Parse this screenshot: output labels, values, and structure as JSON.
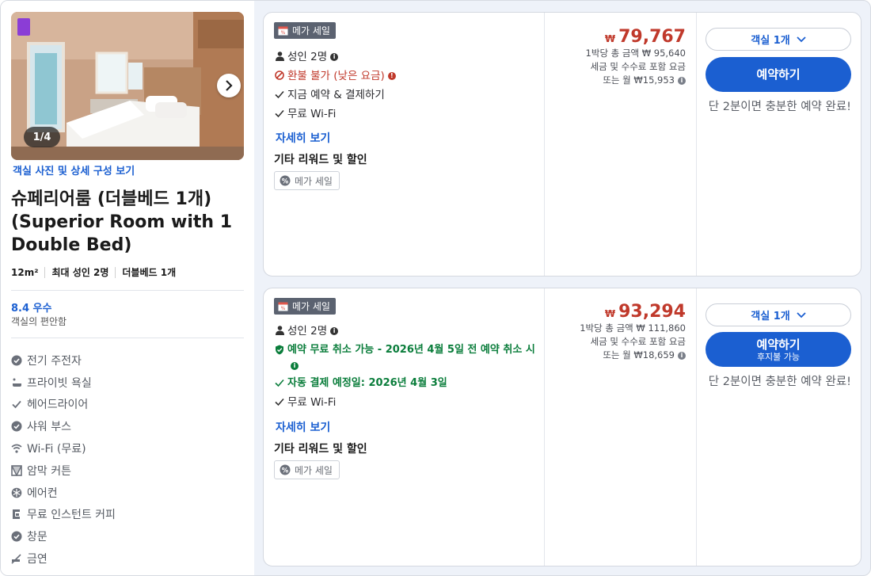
{
  "room": {
    "photo_counter": "1/4",
    "photo_link": "객실 사진 및 상세 구성 보기",
    "title": "슈페리어룸 (더블베드 1개) (Superior Room with 1 Double Bed)",
    "meta": [
      "12m²",
      "최대 성인 2명",
      "더블베드 1개"
    ],
    "rating": "8.4 우수",
    "rating_sub": "객실의 편안함",
    "amenities": [
      {
        "icon": "check-circle-icon",
        "label": "전기 주전자"
      },
      {
        "icon": "bathtub-icon",
        "label": "프라이빗 욕실"
      },
      {
        "icon": "check-icon",
        "label": "헤어드라이어"
      },
      {
        "icon": "check-circle-icon",
        "label": "샤워 부스"
      },
      {
        "icon": "wifi-icon",
        "label": "Wi-Fi (무료)"
      },
      {
        "icon": "blackout-curtain-icon",
        "label": "암막 커튼"
      },
      {
        "icon": "air-conditioner-icon",
        "label": "에어컨"
      },
      {
        "icon": "coffee-maker-icon",
        "label": "무료 인스턴트 커피"
      },
      {
        "icon": "check-circle-icon",
        "label": "창문"
      },
      {
        "icon": "no-smoking-icon",
        "label": "금연"
      }
    ]
  },
  "offers": [
    {
      "badge": "메가 세일",
      "guests": "성인 2명",
      "policy": "환불 불가 (낮은 요금)",
      "payment": "지금 예약 & 결제하기",
      "wifi": "무료 Wi-Fi",
      "details_link": "자세히 보기",
      "other_title": "기타 리워드 및 할인",
      "mini_badge": "메가 세일",
      "currency": "₩",
      "price": "79,767",
      "total_line": "1박당 총 금액 ₩ 95,640",
      "tax_line": "세금 및 수수료 포함 요금",
      "monthly_line": "또는 월 ₩15,953",
      "room_select": "객실 1개",
      "book_label": "예약하기",
      "book_sub": "",
      "note": "단 2분이면 충분한 예약 완료!"
    },
    {
      "badge": "메가 세일",
      "guests": "성인 2명",
      "policy": "예약 무료 취소 가능 - 2026년 4월 5일 전 예약 취소 시",
      "payment": "자동 결제 예정일: 2026년 4월 3일",
      "wifi": "무료 Wi-Fi",
      "details_link": "자세히 보기",
      "other_title": "기타 리워드 및 할인",
      "mini_badge": "메가 세일",
      "currency": "₩",
      "price": "93,294",
      "total_line": "1박당 총 금액 ₩ 111,860",
      "tax_line": "세금 및 수수료 포함 요금",
      "monthly_line": "또는 월 ₩18,659",
      "room_select": "객실 1개",
      "book_label": "예약하기",
      "book_sub": "후지불 가능",
      "note": "단 2분이면 충분한 예약 완료!"
    }
  ],
  "colors": {
    "accent": "#1b5fd1",
    "price": "#c0392b",
    "free_cancel": "#0a7d3b",
    "badge": "#5b6270",
    "photo_tag": "#8b3dd6"
  }
}
